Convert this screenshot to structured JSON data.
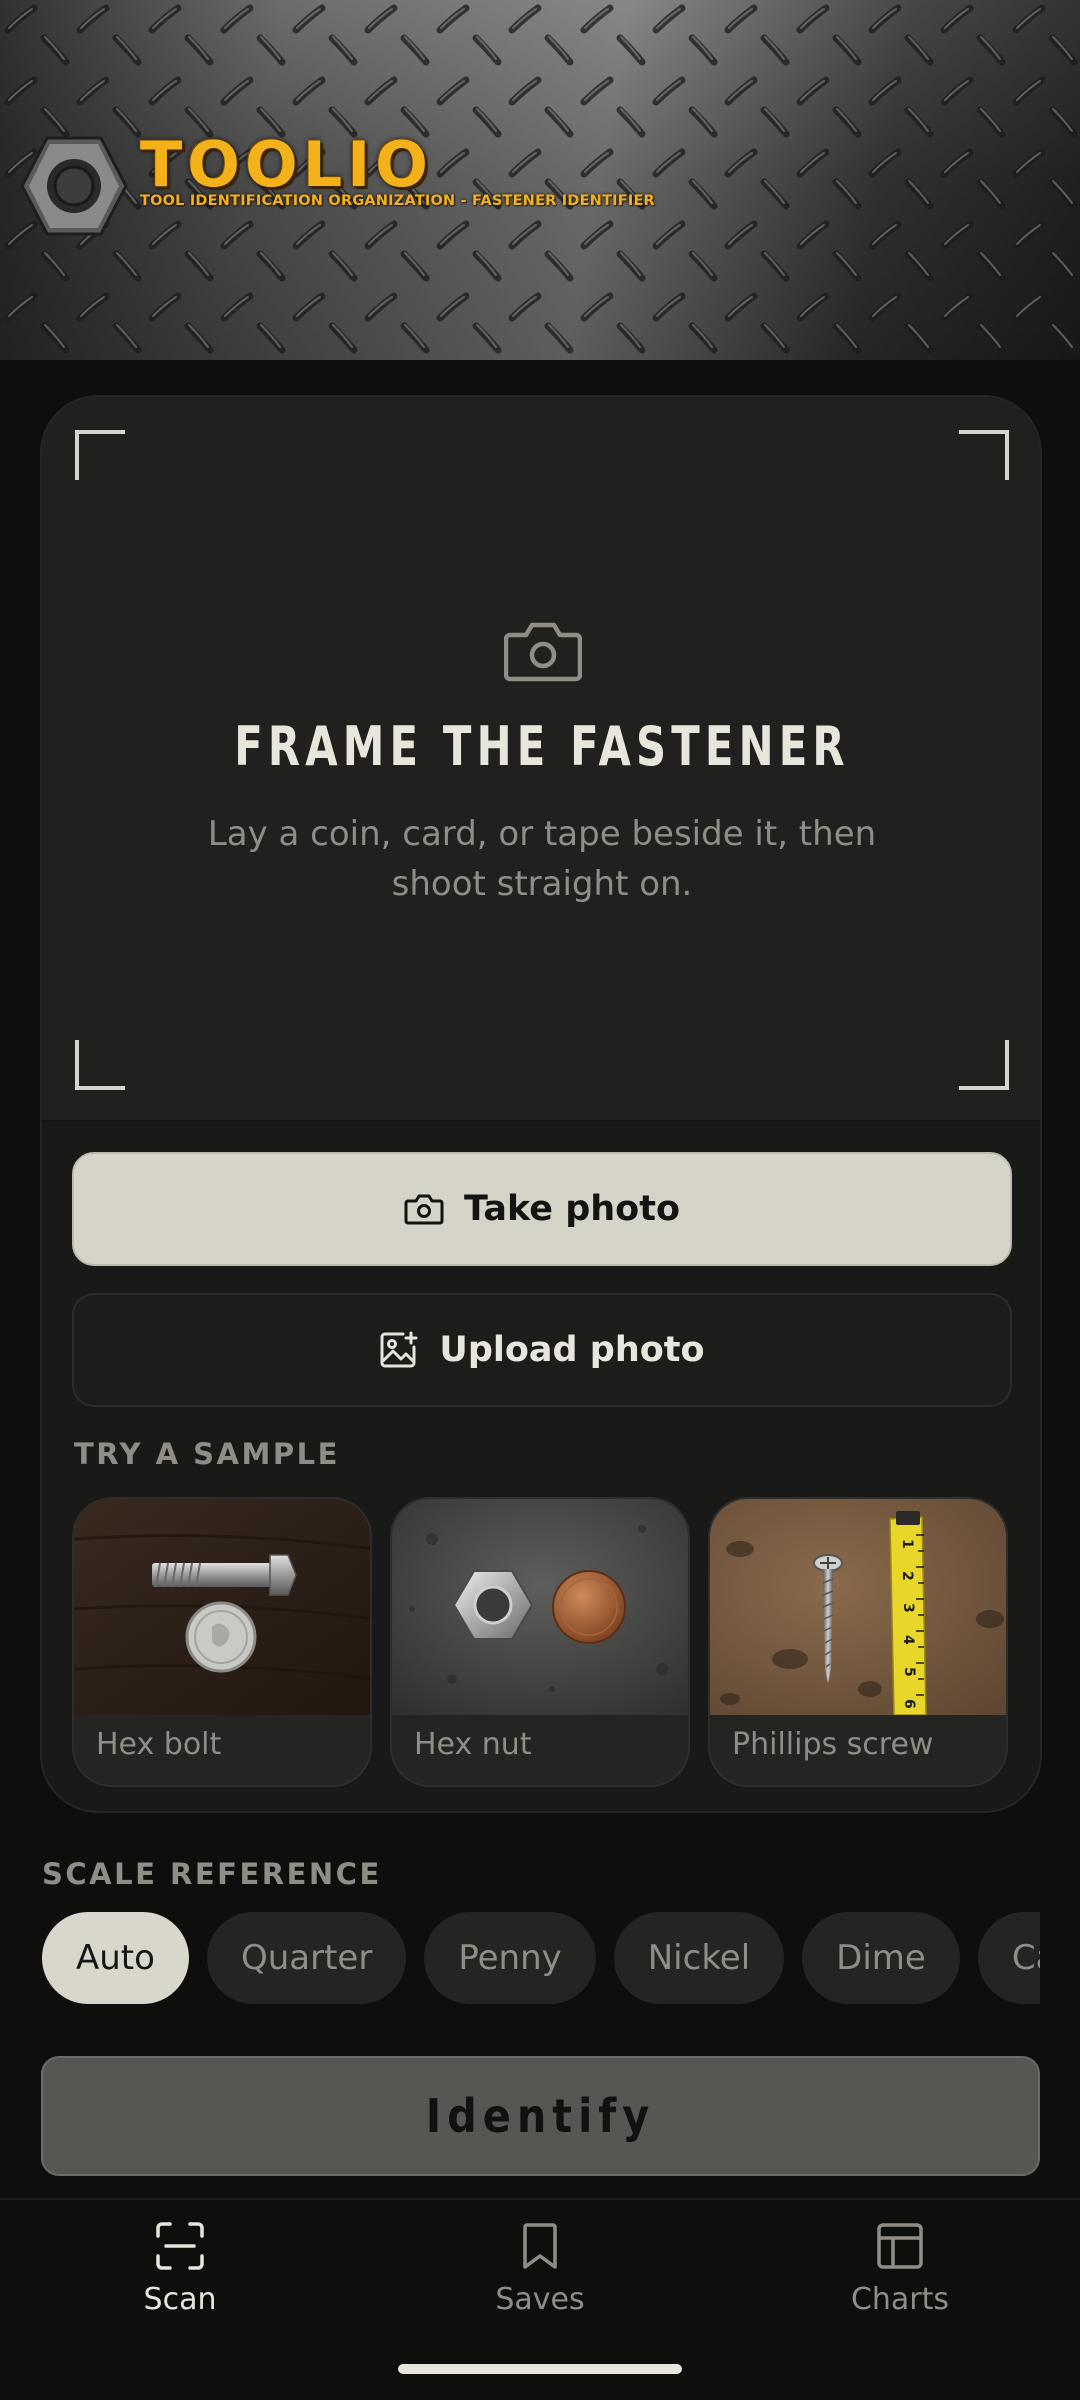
{
  "header": {
    "app_name": "TOOLIO",
    "tagline": "TOOL IDENTIFICATION ORGANIZATION - FASTENER IDENTIFIER",
    "logo_icon": "hex-nut-icon",
    "accent_color": "#f4b21a"
  },
  "viewfinder": {
    "icon": "camera-icon",
    "title": "FRAME THE FASTENER",
    "subtitle": "Lay a coin, card, or tape beside it, then shoot straight on."
  },
  "actions": {
    "take_photo_label": "Take photo",
    "upload_photo_label": "Upload photo"
  },
  "samples": {
    "section_label": "TRY A SAMPLE",
    "items": [
      {
        "name": "Hex bolt"
      },
      {
        "name": "Hex nut"
      },
      {
        "name": "Phillips screw"
      }
    ]
  },
  "scale": {
    "section_label": "SCALE REFERENCE",
    "options": [
      "Auto",
      "Quarter",
      "Penny",
      "Nickel",
      "Dime",
      "Card"
    ],
    "selected": "Auto"
  },
  "identify_label": "Identify",
  "nav": {
    "items": [
      {
        "label": "Scan",
        "icon": "scan-icon",
        "active": true
      },
      {
        "label": "Saves",
        "icon": "bookmark-icon",
        "active": false
      },
      {
        "label": "Charts",
        "icon": "charts-grid-icon",
        "active": false
      }
    ]
  }
}
